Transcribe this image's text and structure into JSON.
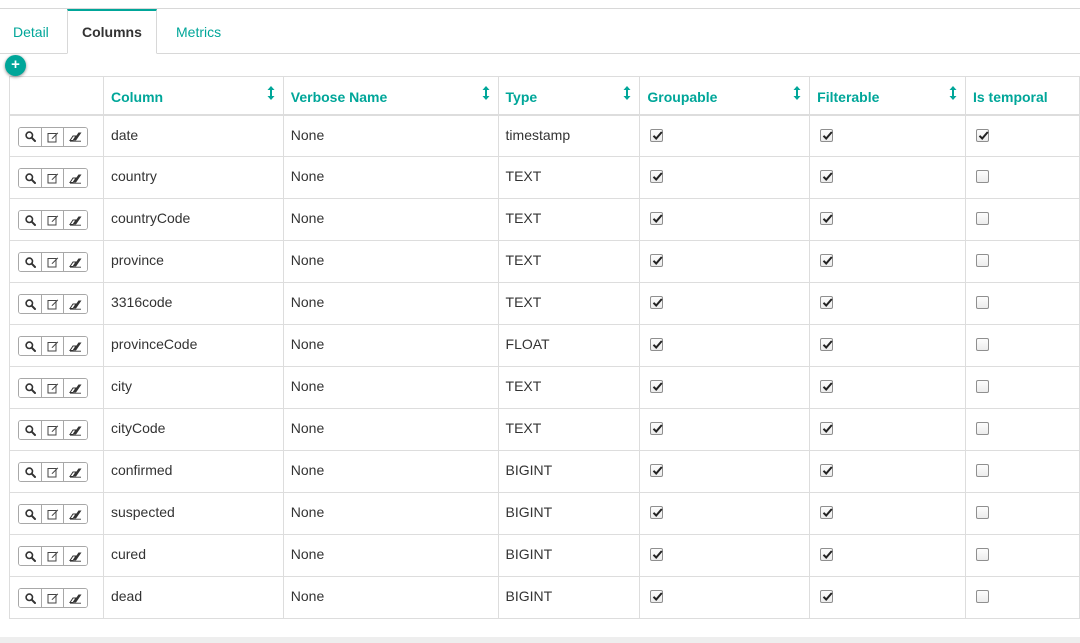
{
  "tabs": [
    {
      "label": "Detail",
      "active": false
    },
    {
      "label": "Columns",
      "active": true
    },
    {
      "label": "Metrics",
      "active": false
    }
  ],
  "add_button": {
    "label": "+",
    "icon": "plus-icon"
  },
  "accent_color": "#00a699",
  "table": {
    "headers": [
      "",
      "Column",
      "Verbose Name",
      "Type",
      "Groupable",
      "Filterable",
      "Is temporal"
    ],
    "row_actions": [
      "search-icon",
      "edit-icon",
      "eraser-icon"
    ],
    "rows": [
      {
        "column": "date",
        "verbose_name": "None",
        "type": "timestamp",
        "groupable": true,
        "filterable": true,
        "is_temporal": true
      },
      {
        "column": "country",
        "verbose_name": "None",
        "type": "TEXT",
        "groupable": true,
        "filterable": true,
        "is_temporal": false
      },
      {
        "column": "countryCode",
        "verbose_name": "None",
        "type": "TEXT",
        "groupable": true,
        "filterable": true,
        "is_temporal": false
      },
      {
        "column": "province",
        "verbose_name": "None",
        "type": "TEXT",
        "groupable": true,
        "filterable": true,
        "is_temporal": false
      },
      {
        "column": "3316code",
        "verbose_name": "None",
        "type": "TEXT",
        "groupable": true,
        "filterable": true,
        "is_temporal": false
      },
      {
        "column": "provinceCode",
        "verbose_name": "None",
        "type": "FLOAT",
        "groupable": true,
        "filterable": true,
        "is_temporal": false
      },
      {
        "column": "city",
        "verbose_name": "None",
        "type": "TEXT",
        "groupable": true,
        "filterable": true,
        "is_temporal": false
      },
      {
        "column": "cityCode",
        "verbose_name": "None",
        "type": "TEXT",
        "groupable": true,
        "filterable": true,
        "is_temporal": false
      },
      {
        "column": "confirmed",
        "verbose_name": "None",
        "type": "BIGINT",
        "groupable": true,
        "filterable": true,
        "is_temporal": false
      },
      {
        "column": "suspected",
        "verbose_name": "None",
        "type": "BIGINT",
        "groupable": true,
        "filterable": true,
        "is_temporal": false
      },
      {
        "column": "cured",
        "verbose_name": "None",
        "type": "BIGINT",
        "groupable": true,
        "filterable": true,
        "is_temporal": false
      },
      {
        "column": "dead",
        "verbose_name": "None",
        "type": "BIGINT",
        "groupable": true,
        "filterable": true,
        "is_temporal": false
      }
    ]
  }
}
